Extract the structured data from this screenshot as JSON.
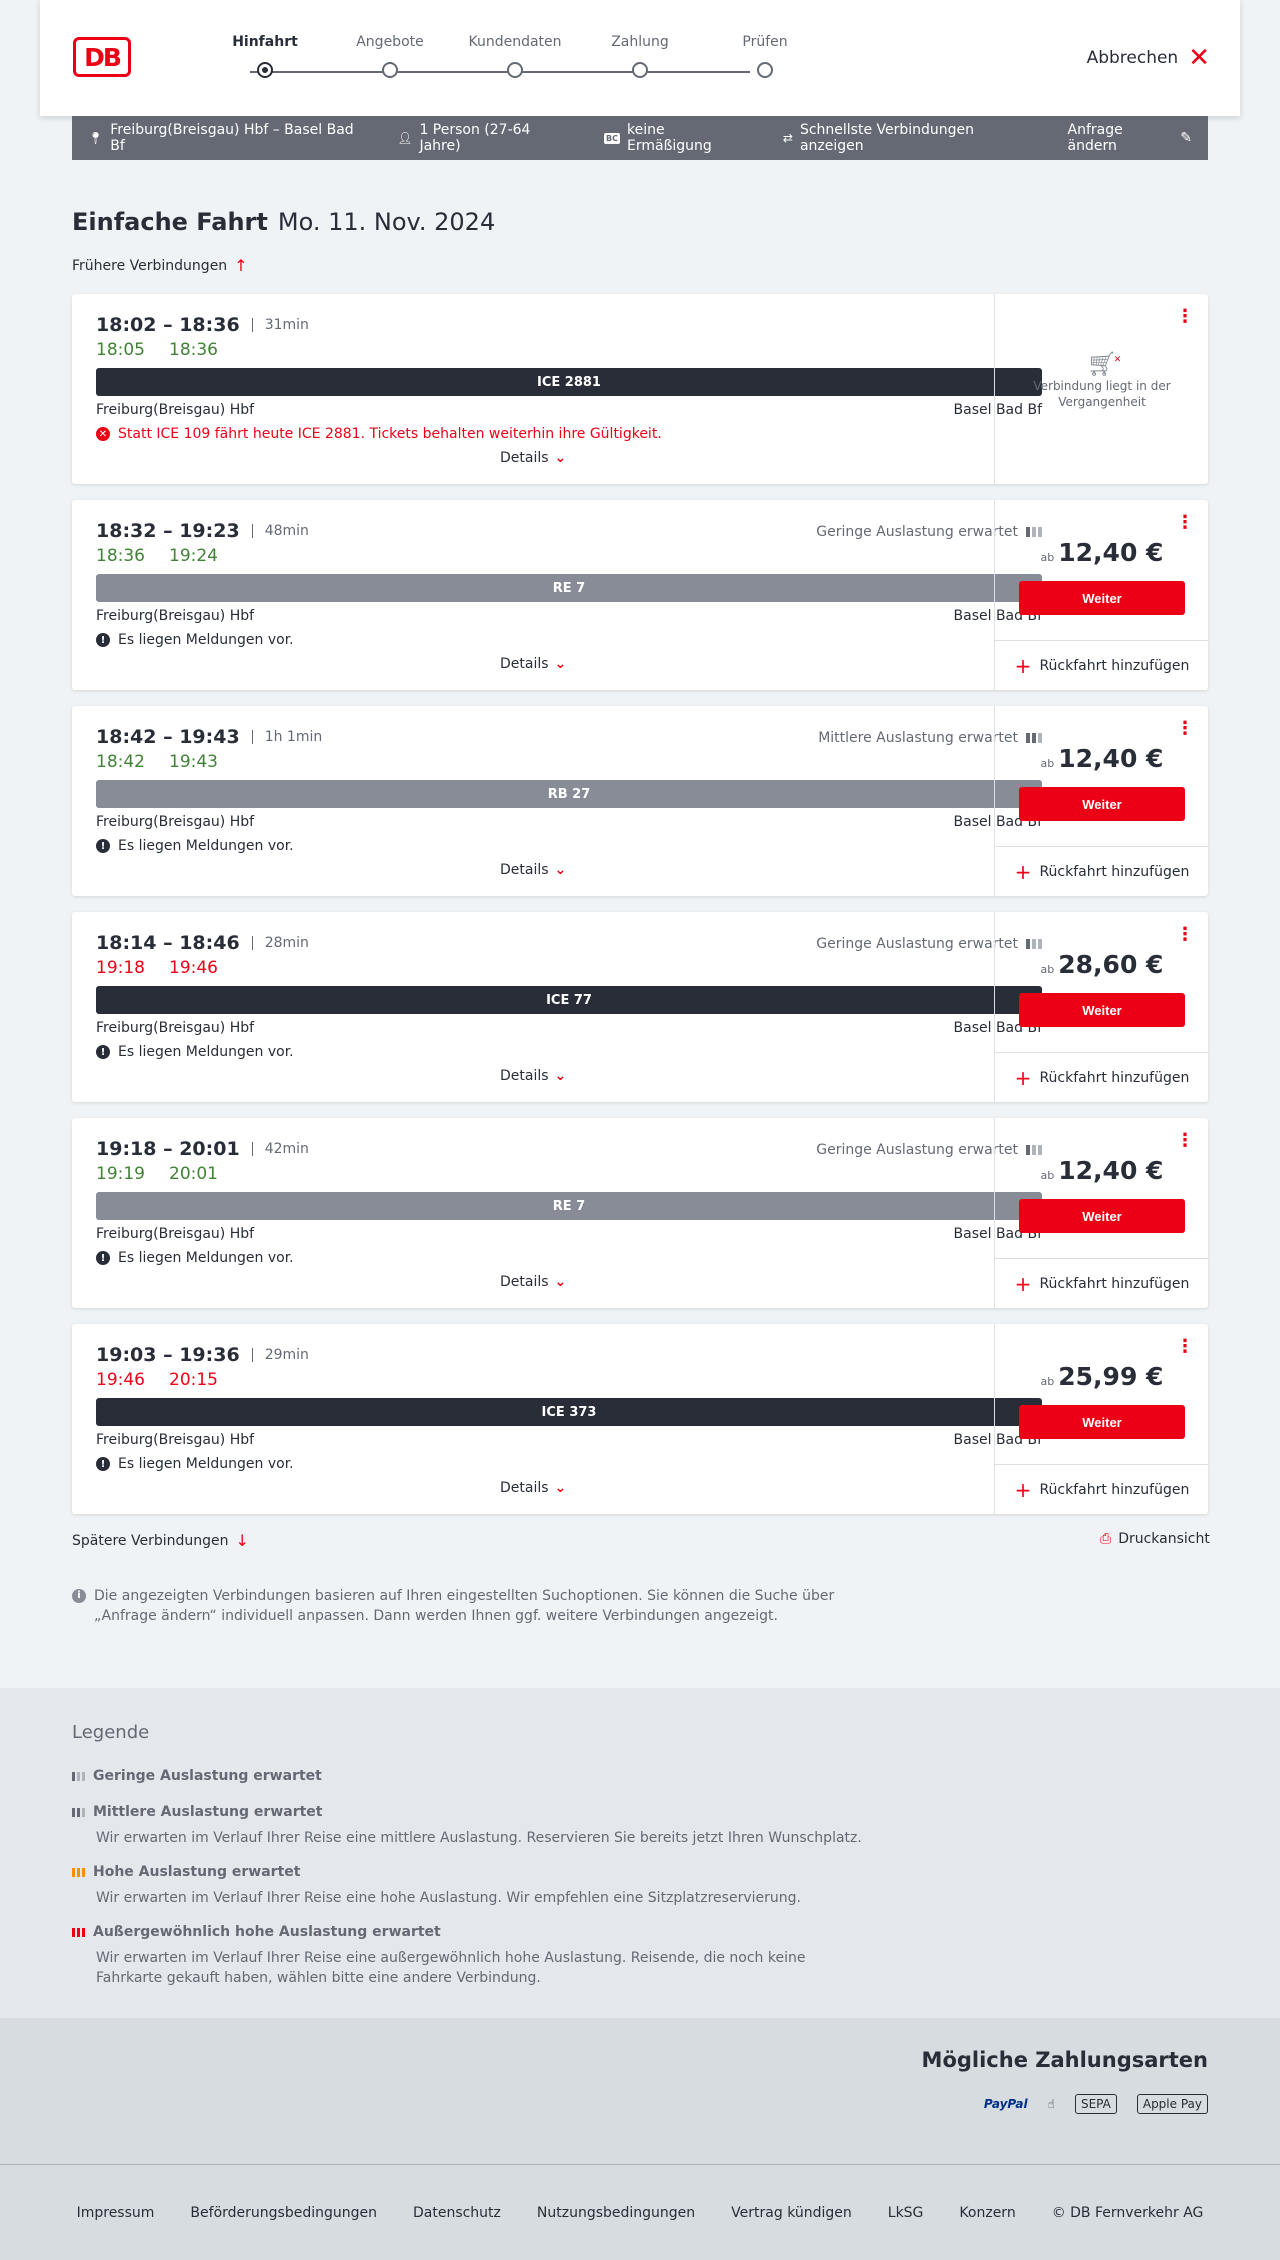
{
  "header": {
    "logo": "DB",
    "steps": [
      "Hinfahrt",
      "Angebote",
      "Kundendaten",
      "Zahlung",
      "Prüfen"
    ],
    "cancel_label": "Abbrechen"
  },
  "summary": {
    "route": "Freiburg(Breisgau) Hbf – Basel Bad Bf",
    "persons": "1 Person (27-64 Jahre)",
    "discount": "keine Ermäßigung",
    "fastest": "Schnellste Verbindungen anzeigen",
    "change": "Anfrage ändern"
  },
  "page": {
    "trip_type": "Einfache Fahrt",
    "date": "Mo. 11. Nov. 2024",
    "earlier": "Frühere Verbindungen",
    "later": "Spätere Verbindungen",
    "print": "Druckansicht",
    "info": "Die angezeigten Verbindungen basieren auf Ihren eingestellten Suchoptionen. Sie können die Suche über „Anfrage ändern“ individuell anpassen. Dann werden Ihnen ggf. weitere Verbindungen angezeigt."
  },
  "common": {
    "from": "Freiburg(Breisgau) Hbf",
    "to": "Basel Bad Bf",
    "details": "Details",
    "ab": "ab",
    "weiter": "Weiter",
    "rueckfahrt": "Rückfahrt hinzufügen",
    "meldungen": "Es liegen Meldungen vor.",
    "past": "Verbindung liegt in der Vergangenheit"
  },
  "connections": [
    {
      "times": "18:02 – 18:36",
      "duration": "31min",
      "rt_dep": "18:05",
      "rt_arr": "18:36",
      "rt_color": "green",
      "load": "",
      "train": "ICE 2881",
      "bar": "dark",
      "message": "Statt ICE 109 fährt heute ICE 2881. Tickets behalten weiterhin ihre Gültigkeit.",
      "price": "",
      "past": true
    },
    {
      "times": "18:32 – 19:23",
      "duration": "48min",
      "rt_dep": "18:36",
      "rt_arr": "19:24",
      "rt_color": "green",
      "load": "Geringe Auslastung erwartet",
      "load_level": 1,
      "train": "RE 7",
      "bar": "gray",
      "price": "12,40 €"
    },
    {
      "times": "18:42 – 19:43",
      "duration": "1h 1min",
      "rt_dep": "18:42",
      "rt_arr": "19:43",
      "rt_color": "green",
      "load": "Mittlere Auslastung erwartet",
      "load_level": 2,
      "train": "RB 27",
      "bar": "gray",
      "price": "12,40 €"
    },
    {
      "times": "18:14 – 18:46",
      "duration": "28min",
      "rt_dep": "19:18",
      "rt_arr": "19:46",
      "rt_color": "red",
      "load": "Geringe Auslastung erwartet",
      "load_level": 1,
      "train": "ICE 77",
      "bar": "dark",
      "price": "28,60 €"
    },
    {
      "times": "19:18 – 20:01",
      "duration": "42min",
      "rt_dep": "19:19",
      "rt_arr": "20:01",
      "rt_color": "green",
      "load": "Geringe Auslastung erwartet",
      "load_level": 1,
      "train": "RE 7",
      "bar": "gray",
      "price": "12,40 €"
    },
    {
      "times": "19:03 – 19:36",
      "duration": "29min",
      "rt_dep": "19:46",
      "rt_arr": "20:15",
      "rt_color": "red",
      "load": "",
      "train": "ICE 373",
      "bar": "dark",
      "price": "25,99 €"
    }
  ],
  "legend": {
    "title": "Legende",
    "items": [
      {
        "title": "Geringe Auslastung erwartet",
        "desc": ""
      },
      {
        "title": "Mittlere Auslastung erwartet",
        "desc": "Wir erwarten im Verlauf Ihrer Reise eine mittlere Auslastung. Reservieren Sie bereits jetzt Ihren Wunschplatz."
      },
      {
        "title": "Hohe Auslastung erwartet",
        "desc": "Wir erwarten im Verlauf Ihrer Reise eine hohe Auslastung. Wir empfehlen eine Sitzplatzreservierung."
      },
      {
        "title": "Außergewöhnlich hohe Auslastung erwartet",
        "desc": "Wir erwarten im Verlauf Ihrer Reise eine außergewöhnlich hohe Auslastung. Reisende, die noch keine Fahrkarte gekauft haben, wählen bitte eine andere Verbindung."
      }
    ]
  },
  "payment": {
    "title": "Mögliche Zahlungsarten",
    "methods": [
      "PayPal",
      "SEPA",
      "Apple Pay"
    ]
  },
  "footer": {
    "links": [
      "Impressum",
      "Beförderungsbedingungen",
      "Datenschutz",
      "Nutzungsbedingungen",
      "Vertrag kündigen",
      "LkSG",
      "Konzern",
      "© DB Fernverkehr AG"
    ]
  },
  "colors": {
    "accent": "#ec0016",
    "dark": "#282d37",
    "green": "#408335",
    "gray": "#646973"
  }
}
